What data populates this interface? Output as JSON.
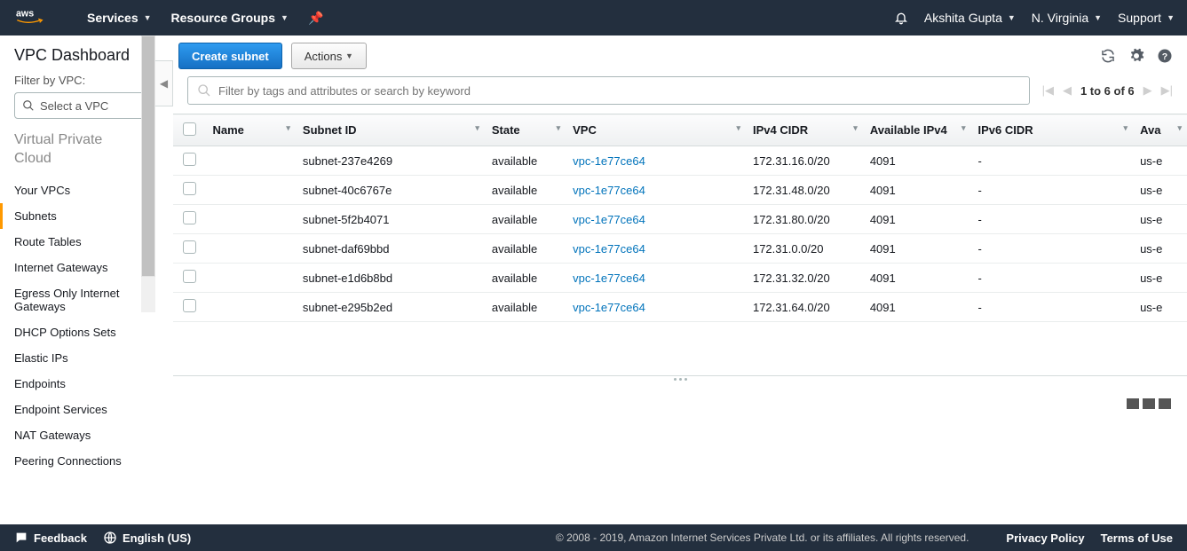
{
  "topnav": {
    "services": "Services",
    "resource_groups": "Resource Groups",
    "user": "Akshita Gupta",
    "region": "N. Virginia",
    "support": "Support"
  },
  "sidebar": {
    "title": "VPC Dashboard",
    "filter_label": "Filter by VPC:",
    "vpc_select_placeholder": "Select a VPC",
    "section": "Virtual Private Cloud",
    "items": [
      "Your VPCs",
      "Subnets",
      "Route Tables",
      "Internet Gateways",
      "Egress Only Internet Gateways",
      "DHCP Options Sets",
      "Elastic IPs",
      "Endpoints",
      "Endpoint Services",
      "NAT Gateways",
      "Peering Connections"
    ],
    "active_index": 1
  },
  "toolbar": {
    "create_label": "Create subnet",
    "actions_label": "Actions"
  },
  "search": {
    "placeholder": "Filter by tags and attributes or search by keyword"
  },
  "pager": {
    "text": "1 to 6 of 6"
  },
  "table": {
    "columns": [
      "Name",
      "Subnet ID",
      "State",
      "VPC",
      "IPv4 CIDR",
      "Available IPv4",
      "IPv6 CIDR",
      "Ava"
    ],
    "rows": [
      {
        "name": "",
        "subnet": "subnet-237e4269",
        "state": "available",
        "vpc": "vpc-1e77ce64",
        "cidr": "172.31.16.0/20",
        "avail": "4091",
        "ipv6": "-",
        "az": "us-e"
      },
      {
        "name": "",
        "subnet": "subnet-40c6767e",
        "state": "available",
        "vpc": "vpc-1e77ce64",
        "cidr": "172.31.48.0/20",
        "avail": "4091",
        "ipv6": "-",
        "az": "us-e"
      },
      {
        "name": "",
        "subnet": "subnet-5f2b4071",
        "state": "available",
        "vpc": "vpc-1e77ce64",
        "cidr": "172.31.80.0/20",
        "avail": "4091",
        "ipv6": "-",
        "az": "us-e"
      },
      {
        "name": "",
        "subnet": "subnet-daf69bbd",
        "state": "available",
        "vpc": "vpc-1e77ce64",
        "cidr": "172.31.0.0/20",
        "avail": "4091",
        "ipv6": "-",
        "az": "us-e"
      },
      {
        "name": "",
        "subnet": "subnet-e1d6b8bd",
        "state": "available",
        "vpc": "vpc-1e77ce64",
        "cidr": "172.31.32.0/20",
        "avail": "4091",
        "ipv6": "-",
        "az": "us-e"
      },
      {
        "name": "",
        "subnet": "subnet-e295b2ed",
        "state": "available",
        "vpc": "vpc-1e77ce64",
        "cidr": "172.31.64.0/20",
        "avail": "4091",
        "ipv6": "-",
        "az": "us-e"
      }
    ]
  },
  "footer": {
    "feedback": "Feedback",
    "language": "English (US)",
    "copyright": "© 2008 - 2019, Amazon Internet Services Private Ltd. or its affiliates. All rights reserved.",
    "privacy": "Privacy Policy",
    "terms": "Terms of Use"
  }
}
